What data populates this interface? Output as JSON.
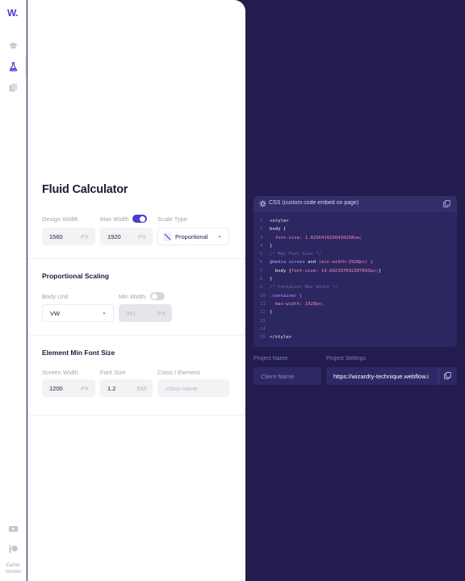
{
  "brand": {
    "logo_text": "W."
  },
  "sidebar": {
    "items": [
      {
        "icon": "graduation-cap-icon"
      },
      {
        "icon": "flask-icon",
        "active": true
      },
      {
        "icon": "copy-icon"
      }
    ],
    "bottom": [
      {
        "icon": "youtube-icon"
      },
      {
        "icon": "patreon-icon"
      }
    ],
    "earlier_line1": "Earlier",
    "earlier_line2": "Version"
  },
  "main": {
    "title": "Fluid Calculator",
    "design_width": {
      "label": "Design Width",
      "value": "1560",
      "unit": "PX"
    },
    "max_width": {
      "label": "Max Width",
      "value": "1920",
      "unit": "PX",
      "toggle_on": true
    },
    "scale_type": {
      "label": "Scale Type",
      "value": "Proportional"
    },
    "proportional": {
      "title": "Proportional Scaling",
      "body_unit": {
        "label": "Body Unit",
        "value": "VW"
      },
      "min_width": {
        "label": "Min Width",
        "placeholder": "991",
        "unit": "PX",
        "toggle_on": false
      }
    },
    "element_min": {
      "title": "Element Min Font Size",
      "screen_width": {
        "label": "Screen Width",
        "value": "1200",
        "unit": "PX"
      },
      "font_size": {
        "label": "Font Size",
        "value": "1.2",
        "unit": "EM"
      },
      "class_element": {
        "label": "Class / Element",
        "placeholder": ".class-name"
      }
    }
  },
  "code": {
    "title": "CSS (custom code embed on page)",
    "lines": [
      {
        "n": "1",
        "t": "<style>"
      },
      {
        "n": "2",
        "t": "body {"
      },
      {
        "n": "3",
        "a": "  font-size: ",
        "b": "1.0256410256410258vw;"
      },
      {
        "n": "4",
        "t": "}"
      },
      {
        "n": "5",
        "c": "/* Max Font Size */"
      },
      {
        "n": "6",
        "a": "@media screen",
        "m": " and ",
        "b": "(min-width:1920px) {"
      },
      {
        "n": "7",
        "a": "  body {",
        "b": "font-size: 19.692307692307693px;",
        "e": "}"
      },
      {
        "n": "8",
        "t": "}"
      },
      {
        "n": "9",
        "c": "/* Container Max Width */"
      },
      {
        "n": "10",
        "p": ".container {"
      },
      {
        "n": "11",
        "a": "  max-width: ",
        "b": "1920px;"
      },
      {
        "n": "12",
        "t": "}"
      },
      {
        "n": "13",
        "t": ""
      },
      {
        "n": "14",
        "t": ""
      },
      {
        "n": "15",
        "t": "</style>"
      }
    ]
  },
  "project": {
    "name_label": "Project Name",
    "name_placeholder": "Client Name",
    "settings_label": "Project Settings",
    "settings_value": "https://wizardry-technique.webflow.i"
  },
  "colors": {
    "accent": "#4a3ec8",
    "dark_bg": "#221d4e",
    "code_bg": "#2c2760"
  }
}
